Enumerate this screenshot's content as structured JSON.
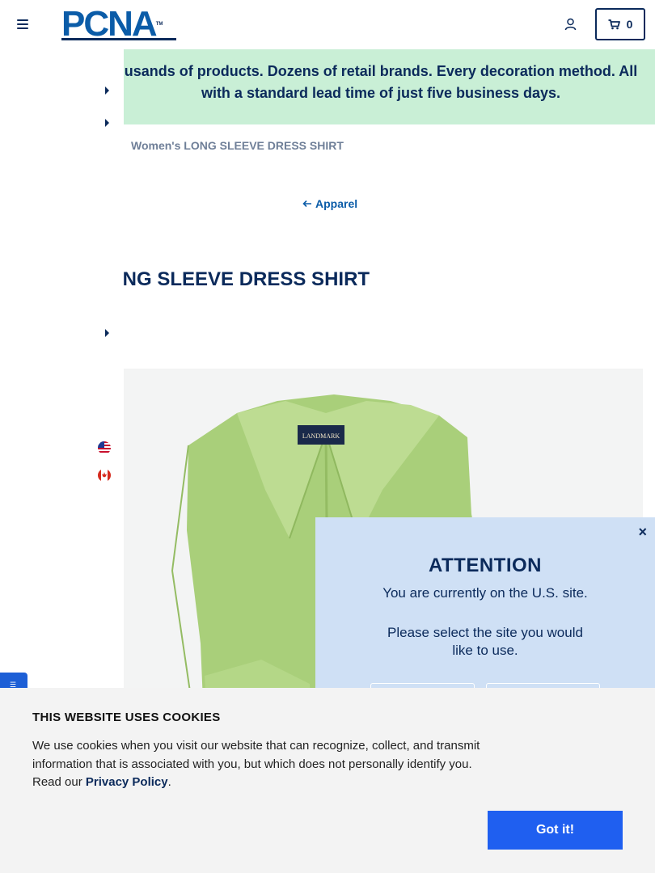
{
  "header": {
    "logo_text": "PCNA",
    "logo_tm": "TM",
    "cart_count": "0"
  },
  "promo": {
    "line1": "usands of products. Dozens of retail brands. Every decoration method. All",
    "line2": "with a standard lead time of just five business days."
  },
  "breadcrumb": "Women's LONG SLEEVE DRESS SHIRT",
  "back_link": "Apparel",
  "product_title": "ONG SLEEVE DRESS SHIRT",
  "product_image": {
    "label": "LANDMARK",
    "color": "#a9cf7a"
  },
  "side_tab_label": "☰",
  "attention": {
    "title": "ATTENTION",
    "line1": "You are currently on the U.S. site.",
    "line2": "Please select the site you would",
    "line3": "like to use.",
    "close": "×"
  },
  "cookie": {
    "title": "THIS WEBSITE USES COOKIES",
    "text_before": "We use cookies when you visit our website that can recognize, collect, and transmit information that is associated with you, but which does not personally identify you. Read our ",
    "link": "Privacy Policy",
    "text_after": ".",
    "button": "Got it!"
  },
  "colors": {
    "navy": "#0b2a5b",
    "brand_blue": "#0b5ca8",
    "promo_bg": "#c9efd6",
    "button_blue": "#1f5ff0"
  }
}
